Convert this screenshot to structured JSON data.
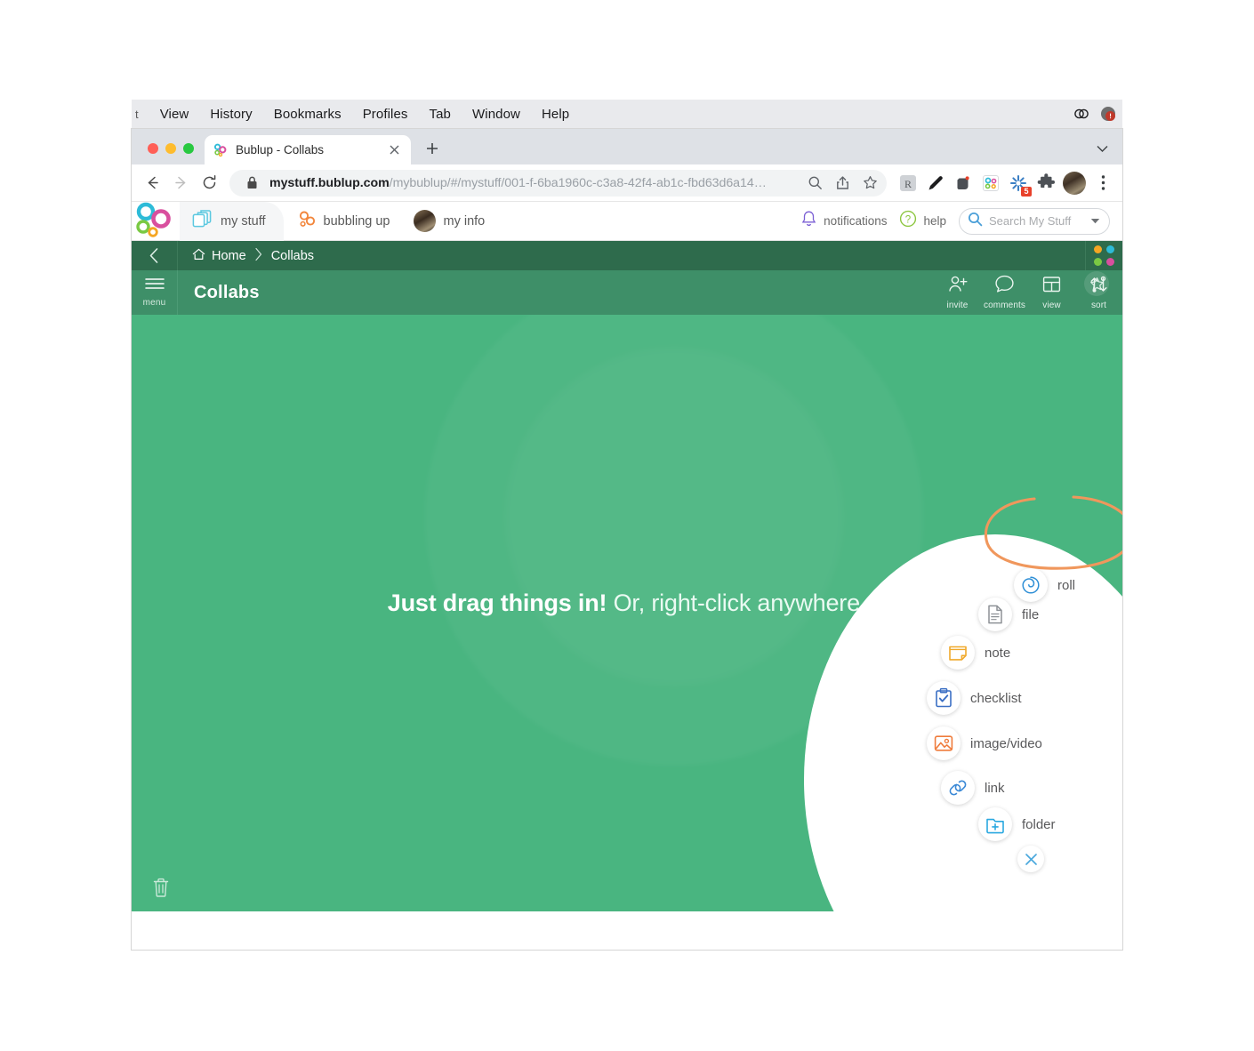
{
  "os_menubar": {
    "items": [
      "View",
      "History",
      "Bookmarks",
      "Profiles",
      "Tab",
      "Window",
      "Help"
    ],
    "status_icons": [
      "creative-cloud-icon",
      "alert-badge-icon"
    ]
  },
  "browser": {
    "tab": {
      "title": "Bublup - Collabs",
      "favicon": "bublup-bubbles-favicon",
      "close_label": "×"
    },
    "new_tab_label": "+",
    "tabstrip_chevron": "chevron-down-icon",
    "nav": {
      "back": "back-arrow-icon",
      "forward": "forward-arrow-icon",
      "reload": "reload-icon"
    },
    "omnibox": {
      "lock_icon": "lock-icon",
      "url_host": "mystuff.bublup.com",
      "url_path": "/mybublup/#/mystuff/001-f-6ba1960c-c3a8-42f4-ab1c-fbd63d6a14…",
      "zoom_icon": "search-zoom-icon",
      "share_icon": "share-icon",
      "bookmark_icon": "star-outline-icon"
    },
    "extensions": [
      {
        "name": "readability-extension-icon",
        "badge": ""
      },
      {
        "name": "pen-edit-extension-icon",
        "badge": ""
      },
      {
        "name": "evernote-extension-icon",
        "badge": ""
      },
      {
        "name": "bublup-extension-icon",
        "badge": ""
      },
      {
        "name": "asterisk-extension-icon",
        "badge": "5"
      },
      {
        "name": "puzzle-extensions-icon",
        "badge": ""
      }
    ],
    "profile_avatar": "profile-avatar",
    "menu_icon": "kebab-menu-icon"
  },
  "app_header": {
    "logo": "bublup-logo",
    "nav": [
      {
        "label": "my stuff",
        "icon": "folders-icon",
        "active": true
      },
      {
        "label": "bubbling up",
        "icon": "bubbles-icon",
        "active": false
      },
      {
        "label": "my info",
        "icon": "user-avatar",
        "active": false
      }
    ],
    "notifications_label": "notifications",
    "notifications_icon": "bell-icon",
    "help_label": "help",
    "help_icon": "question-circle-icon",
    "search": {
      "placeholder": "Search My Stuff",
      "value": "",
      "icon": "search-icon",
      "dropdown_icon": "caret-down-icon"
    }
  },
  "breadcrumb": {
    "back_icon": "chevron-left-icon",
    "items": [
      {
        "label": "Home",
        "icon": "home-icon"
      },
      {
        "label": "Collabs",
        "icon": ""
      }
    ],
    "separator": "›",
    "grid_dots": [
      "#f5a623",
      "#2dbbd8",
      "#7ac943",
      "#d94f9e"
    ]
  },
  "toolbar": {
    "menu_caption": "menu",
    "menu_icon": "hamburger-icon",
    "folder_title": "Collabs",
    "actions": [
      {
        "label": "invite",
        "icon": "person-plus-icon"
      },
      {
        "label": "comments",
        "icon": "speech-bubble-icon"
      },
      {
        "label": "view",
        "icon": "layout-grid-icon"
      },
      {
        "label": "sort",
        "icon": "sort-arrows-icon"
      }
    ]
  },
  "canvas": {
    "star_icon": "star-outline-icon",
    "trash_icon": "trash-icon",
    "empty_message_bold": "Just drag things in!",
    "empty_message_light": "Or, right-click anywhere.",
    "background_color": "#49b580"
  },
  "add_menu": {
    "items": [
      {
        "label": "roll",
        "icon": "spiral-roll-icon",
        "color": "#2f8fd6"
      },
      {
        "label": "file",
        "icon": "document-file-icon",
        "color": "#8d9196"
      },
      {
        "label": "note",
        "icon": "sticky-note-icon",
        "color": "#f0a92c"
      },
      {
        "label": "checklist",
        "icon": "clipboard-check-icon",
        "color": "#3b6fc4"
      },
      {
        "label": "image/video",
        "icon": "image-photo-icon",
        "color": "#ef7c3c"
      },
      {
        "label": "link",
        "icon": "chain-link-icon",
        "color": "#3b89d6"
      },
      {
        "label": "folder",
        "icon": "folder-plus-icon",
        "color": "#2aa8e0"
      }
    ],
    "close_icon": "close-x-icon",
    "close_color": "#4aa8dd",
    "highlight_color": "#f0975c",
    "highlighted_item": "folder"
  }
}
